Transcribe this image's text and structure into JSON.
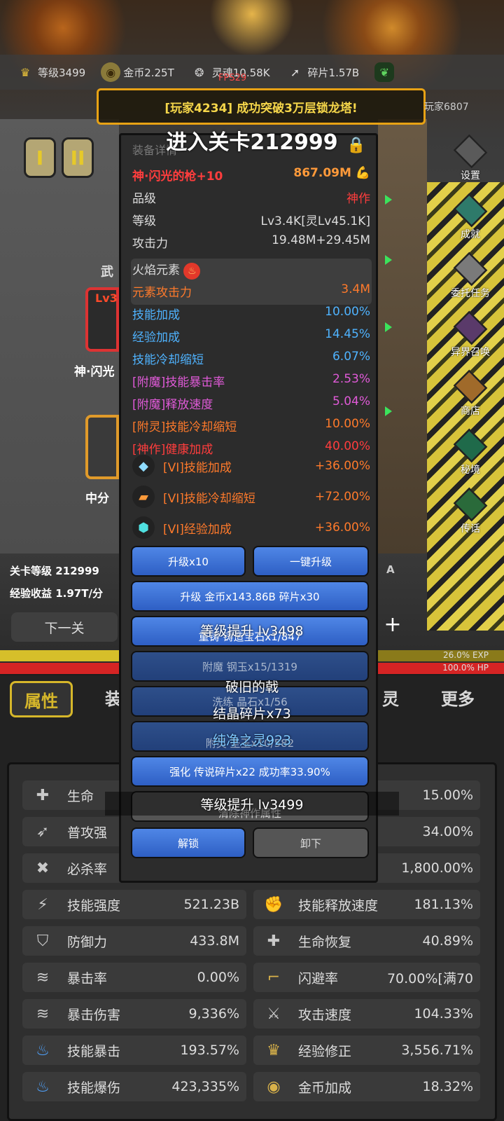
{
  "top_resources": [
    {
      "icon": "crown-icon",
      "label": "等级3499",
      "color": "#e8c23a"
    },
    {
      "icon": "gold-coin-icon",
      "label": "金币2.25T",
      "color": "#d9b24a"
    },
    {
      "icon": "soul-icon",
      "label": "灵魂10.58K",
      "color": "#c9c9c9"
    },
    {
      "icon": "shard-icon",
      "label": "碎片1.57B",
      "color": "#dddddd"
    }
  ],
  "fps": "FPS29",
  "broadcast": "[玩家4234] 成功突破3万层锁龙塔!",
  "broadcast_right": "玩家6807",
  "stage_title": "进入关卡212999",
  "stage_tabs": [
    "I",
    "II"
  ],
  "side_menu": [
    "设置",
    "成就",
    "委托任务",
    "异界召唤",
    "商店",
    "秘境",
    "传话"
  ],
  "left_scene": {
    "weapon_hint": "武",
    "level_hint": "Lv3",
    "weapon_name_hint": "神·闪光",
    "other_hint": "中分"
  },
  "panel": {
    "title": "装备详情",
    "weapon_name": "神·闪光的枪+10",
    "power": "867.09M",
    "rows": [
      {
        "label": "品级",
        "value": "神作"
      },
      {
        "label": "等级",
        "value": "Lv3.4K[灵Lv45.1K]"
      },
      {
        "label": "攻击力",
        "value": "19.48M+29.45M"
      }
    ],
    "element_title": "火焰元素",
    "element_attack_label": "元素攻击力",
    "element_attack_value": "3.4M",
    "stats": [
      {
        "label": "技能加成",
        "value": "10.00%",
        "color": "#4fb3ff"
      },
      {
        "label": "经验加成",
        "value": "14.45%",
        "color": "#4fb3ff"
      },
      {
        "label": "技能冷却缩短",
        "value": "6.07%",
        "color": "#4fb3ff"
      },
      {
        "label": "[附魔]技能暴击率",
        "value": "2.53%",
        "color": "#e05ad8"
      },
      {
        "label": "[附魔]释放速度",
        "value": "5.04%",
        "color": "#e05ad8"
      },
      {
        "label": "[附灵]技能冷却缩短",
        "value": "10.00%",
        "color": "#ff7a2b"
      },
      {
        "label": "[神作]健康加成",
        "value": "40.00%",
        "color": "#ff3d3d"
      }
    ],
    "gems": [
      {
        "icon": "diamond-gem-icon",
        "label": "[VI]技能加成",
        "value": "+36.00%",
        "color": "#8fdcff"
      },
      {
        "icon": "amber-gem-icon",
        "label": "[VI]技能冷却缩短",
        "value": "+72.00%",
        "color": "#ff9a3a"
      },
      {
        "icon": "aqua-gem-icon",
        "label": "[VI]经验加成",
        "value": "+36.00%",
        "color": "#4fe0e0"
      }
    ],
    "buttons": {
      "upgrade_x10": "升级x10",
      "one_key_upgrade": "一键升级",
      "upgrade_cost": "升级 金币x143.86B 碎片x30",
      "reforge": "重铸 铸造宝石x1/847",
      "enchant": "附魔 钢玉x15/1319",
      "crystal": "洗练 晶石x1/56",
      "attach_spirit": "附灵 圣玉x10/582",
      "strengthen": "强化 传说碎片x22 成功率33.90%",
      "clear_divine": "清除神作属性",
      "unlock": "解锁",
      "unequip": "卸下"
    }
  },
  "overlay_messages": {
    "level_up_1": "等级提升 lv3498",
    "broken_halberd": "破旧的戟",
    "crystal_shards": "结晶碎片x73",
    "pure_spirit": "纯净之灵923",
    "level_up_2": "等级提升 lv3499"
  },
  "left_info": {
    "stage_level": "关卡等级 212999",
    "exp_income": "经验收益 1.97T/分",
    "next_stage": "下一关",
    "right_letter": "A"
  },
  "bars": {
    "exp": "26.0% EXP",
    "hp": "100.0% HP",
    "exp_fraction": 0.26,
    "hp_fraction": 1.0
  },
  "bottom_tabs": [
    "属性",
    "装",
    "灵",
    "更多"
  ],
  "attributes": [
    {
      "icon": "cross-icon",
      "label": "生命",
      "value": "",
      "side": "left"
    },
    {
      "icon": "",
      "label": "",
      "value": "15.00%",
      "side": "right"
    },
    {
      "icon": "sword-icon",
      "label": "普攻强",
      "value": "",
      "side": "left"
    },
    {
      "icon": "",
      "label": "",
      "value": "34.00%",
      "side": "right"
    },
    {
      "icon": "crit-icon",
      "label": "必杀率",
      "value": "",
      "side": "left"
    },
    {
      "icon": "",
      "label": "",
      "value": "1,800.00%",
      "side": "right"
    },
    {
      "icon": "lightning-icon",
      "label": "技能强度",
      "value": "521.23B",
      "side": "left"
    },
    {
      "icon": "fist-icon",
      "label": "技能释放速度",
      "value": "181.13%",
      "side": "right"
    },
    {
      "icon": "shield-icon",
      "label": "防御力",
      "value": "433.8M",
      "side": "left"
    },
    {
      "icon": "heal-icon",
      "label": "生命恢复",
      "value": "40.89%",
      "side": "right"
    },
    {
      "icon": "claw-icon",
      "label": "暴击率",
      "value": "0.00%",
      "side": "left"
    },
    {
      "icon": "boot-icon",
      "label": "闪避率",
      "value": "70.00%[满70",
      "side": "right"
    },
    {
      "icon": "claw-icon",
      "label": "暴击伤害",
      "value": "9,336%",
      "side": "left"
    },
    {
      "icon": "swords-icon",
      "label": "攻击速度",
      "value": "104.33%",
      "side": "right"
    },
    {
      "icon": "blue-flame-icon",
      "label": "技能暴击",
      "value": "193.57%",
      "side": "left"
    },
    {
      "icon": "crown-icon",
      "label": "经验修正",
      "value": "3,556.71%",
      "side": "right"
    },
    {
      "icon": "blue-flame-icon",
      "label": "技能爆伤",
      "value": "423,335%",
      "side": "left"
    },
    {
      "icon": "gold-coin-icon",
      "label": "金币加成",
      "value": "18.32%",
      "side": "right"
    }
  ]
}
